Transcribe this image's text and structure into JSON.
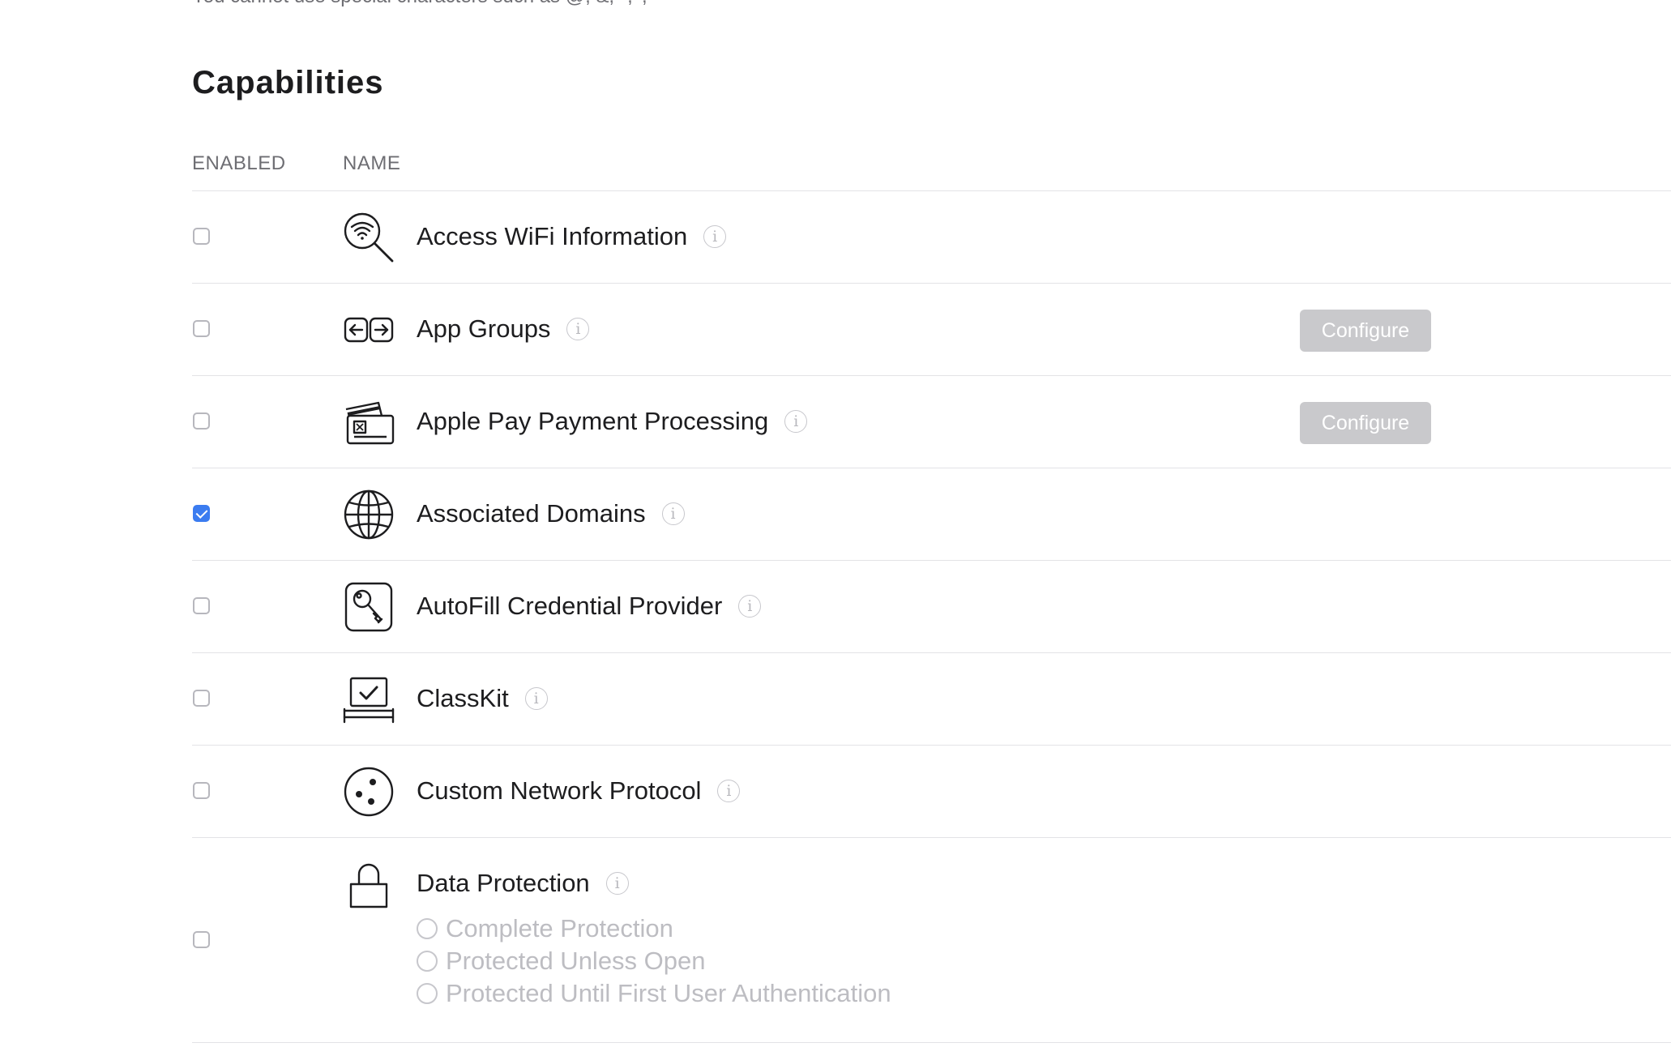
{
  "top_note": "You cannot use special characters such as @, &, *, ', \"",
  "section_title": "Capabilities",
  "columns": {
    "enabled": "ENABLED",
    "name": "NAME"
  },
  "info_glyph": "i",
  "configure_label": "Configure",
  "capabilities": [
    {
      "name": "Access WiFi Information",
      "icon": "wifi-magnifier-icon",
      "enabled": false,
      "configure": false
    },
    {
      "name": "App Groups",
      "icon": "app-groups-icon",
      "enabled": false,
      "configure": true
    },
    {
      "name": "Apple Pay Payment Processing",
      "icon": "payment-cards-icon",
      "enabled": false,
      "configure": true
    },
    {
      "name": "Associated Domains",
      "icon": "globe-icon",
      "enabled": true,
      "configure": false
    },
    {
      "name": "AutoFill Credential Provider",
      "icon": "key-icon",
      "enabled": false,
      "configure": false
    },
    {
      "name": "ClassKit",
      "icon": "classkit-icon",
      "enabled": false,
      "configure": false
    },
    {
      "name": "Custom Network Protocol",
      "icon": "network-dots-icon",
      "enabled": false,
      "configure": false
    },
    {
      "name": "Data Protection",
      "icon": "lock-icon",
      "enabled": false,
      "configure": false,
      "options": [
        "Complete Protection",
        "Protected Unless Open",
        "Protected Until First User Authentication"
      ]
    }
  ],
  "colors": {
    "checkbox_checked": "#3b7cf0",
    "configure_button": "#c9c9cc",
    "divider": "#e3e3e6",
    "disabled_text": "#bdbdc2"
  }
}
